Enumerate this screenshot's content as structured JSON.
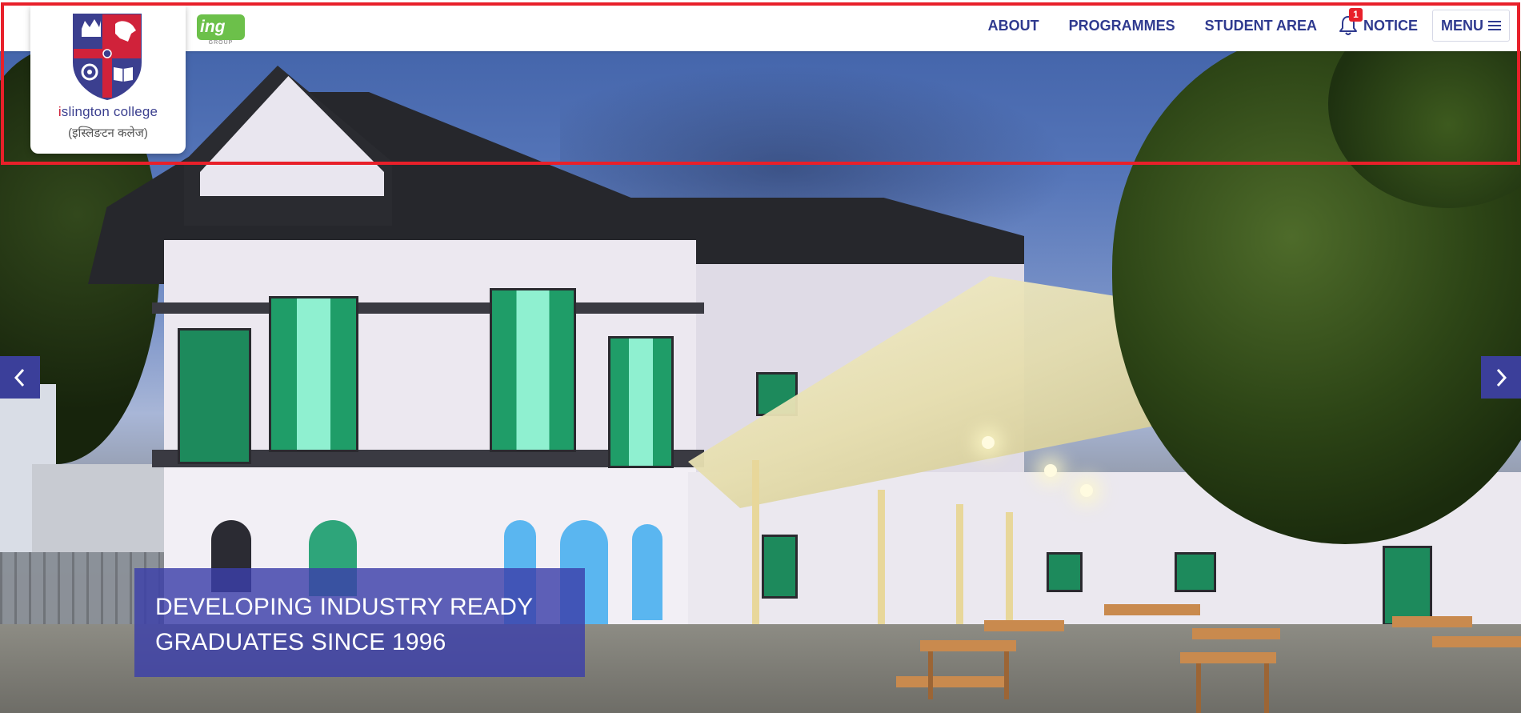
{
  "brand": {
    "college_name_prefix": "i",
    "college_name_rest": "slington college",
    "college_name_nepali": "(इस्लिङटन कलेज)",
    "partner_logo_text": "ing",
    "partner_logo_sub": "GROUP",
    "primary_color": "#2f3a8f",
    "accent_color": "#d0223a"
  },
  "nav": {
    "items": [
      {
        "label": "ABOUT"
      },
      {
        "label": "PROGRAMMES"
      },
      {
        "label": "STUDENT AREA"
      }
    ],
    "notice_label": "NOTICE",
    "notice_badge": "1",
    "menu_label": "MENU",
    "icons": [
      "bell-icon",
      "hamburger-icon"
    ]
  },
  "hero": {
    "caption_line1": "DEVELOPING INDUSTRY READY",
    "caption_line2": "GRADUATES SINCE 1996",
    "arrows": [
      "chevron-left-icon",
      "chevron-right-icon"
    ],
    "caption_bg": "#3c40aa"
  },
  "annotation": {
    "highlight_color": "#e8202a"
  }
}
